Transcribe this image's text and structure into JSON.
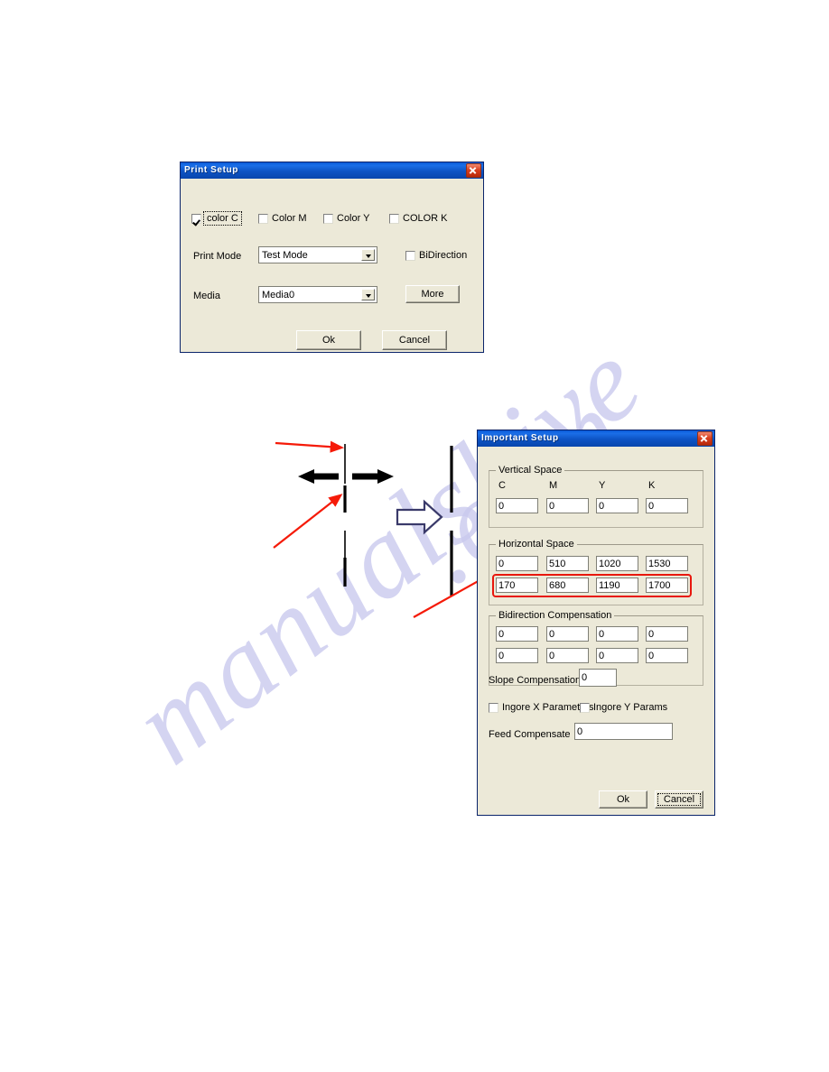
{
  "page": {
    "watermark_line1": "manualshive",
    "watermark_line2": ".com"
  },
  "print_setup_dialog": {
    "title": "Print Setup",
    "close_label": "×",
    "color_checkboxes": [
      {
        "label": "color   C",
        "checked": true,
        "focused": true
      },
      {
        "label": "Color M",
        "checked": false,
        "focused": false
      },
      {
        "label": "Color Y",
        "checked": false,
        "focused": false
      },
      {
        "label": "COLOR K",
        "checked": false,
        "focused": false
      }
    ],
    "print_mode_label": "Print Mode",
    "print_mode_value": "Test   Mode",
    "bidirection_label": "BiDirection",
    "bidirection_checked": false,
    "media_label": "Media",
    "media_value": "Media0",
    "more_button": "More",
    "ok_button": "Ok",
    "cancel_button": "Cancel"
  },
  "important_setup_dialog": {
    "title": "Important Setup",
    "close_label": "×",
    "vertical_space": {
      "group_title": "Vertical Space",
      "column_headers": [
        "C",
        "M",
        "Y",
        "K"
      ],
      "values": [
        "0",
        "0",
        "0",
        "0"
      ]
    },
    "horizontal_space": {
      "group_title": "Horizontal Space",
      "row1": [
        "0",
        "510",
        "1020",
        "1530"
      ],
      "row2": [
        "170",
        "680",
        "1190",
        "1700"
      ],
      "row2_highlight_color": "#e8170d"
    },
    "bidirection_compensation": {
      "group_title": "Bidirection Compensation",
      "row1": [
        "0",
        "0",
        "0",
        "0"
      ],
      "row2": [
        "0",
        "0",
        "0",
        "0"
      ]
    },
    "slope_compensation_label": "Slope Compensation",
    "slope_compensation_value": "0",
    "ingore_x_label": "Ingore X Parameters",
    "ingore_x_checked": false,
    "ingore_y_label": "Ingore Y Params",
    "ingore_y_checked": false,
    "feed_compensate_label": "Feed Compensate",
    "feed_compensate_value": "0",
    "ok_button": "Ok",
    "cancel_button": "Cancel",
    "cancel_focused": true
  },
  "diagram": {
    "arrow_color_red": "#f51a08",
    "arrow_color_black": "#000000",
    "block_arrow_outline": "#3a3a6a"
  }
}
